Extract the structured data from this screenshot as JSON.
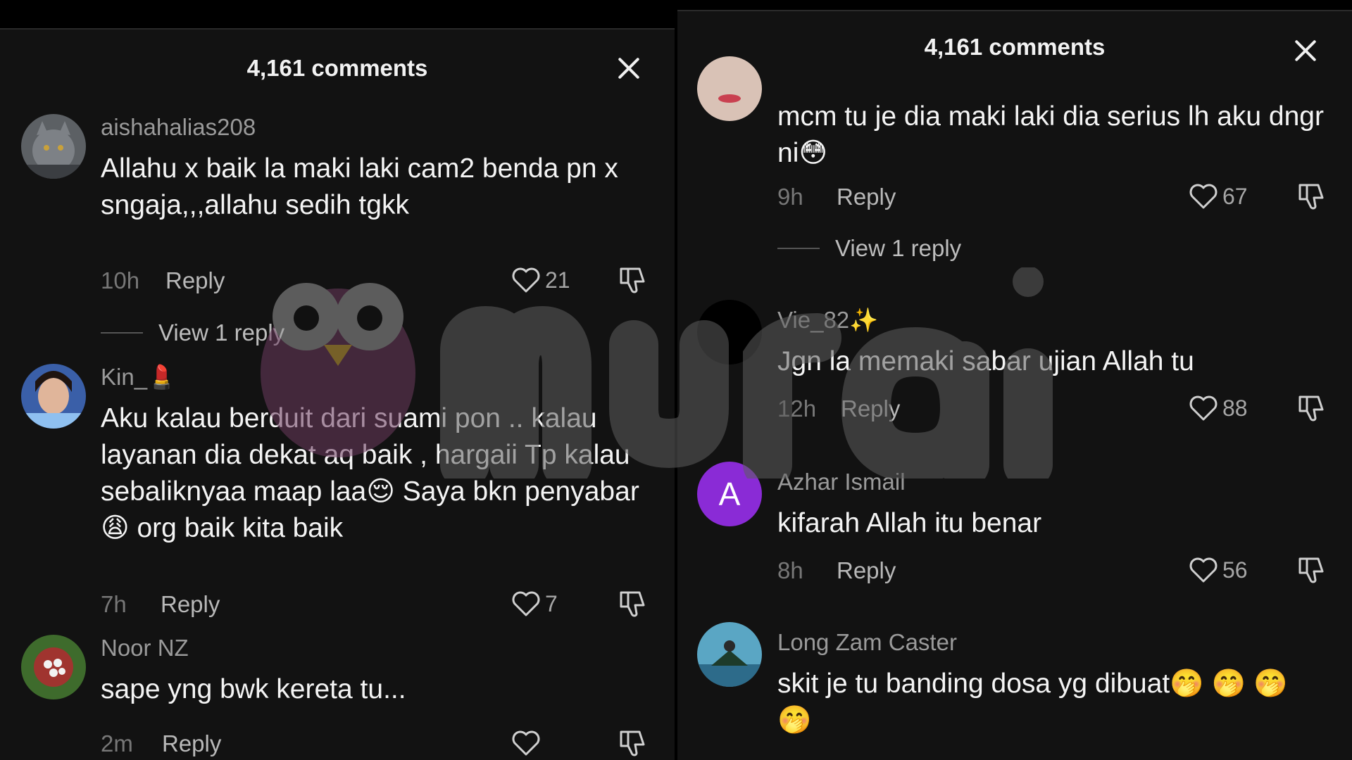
{
  "left": {
    "header_title": "4,161 comments",
    "comments": [
      {
        "username": "aishahalias208",
        "text": "Allahu x baik la maki laki cam2 benda pn x sngaja,,,allahu sedih tgkk",
        "time": "10h",
        "reply_label": "Reply",
        "likes": "21",
        "view_replies": "View 1 reply"
      },
      {
        "username": "Kin_💄",
        "text": "Aku kalau berduit dari suami pon .. kalau layanan dia dekat aq baik , hargaii Tp kalau sebaliknyaa maap laa😌 Saya bkn penyabar 😩 org baik kita baik",
        "time": "7h",
        "reply_label": "Reply",
        "likes": "7"
      },
      {
        "username": "Noor NZ",
        "text": "sape yng bwk kereta tu...",
        "time": "2m",
        "reply_label": "Reply",
        "likes": ""
      }
    ]
  },
  "right": {
    "header_title": "4,161 comments",
    "comments": [
      {
        "username": "",
        "text": "mcm tu je dia maki laki dia serius lh aku dngr ni😳",
        "time": "9h",
        "reply_label": "Reply",
        "likes": "67",
        "view_replies": "View 1 reply"
      },
      {
        "username": "Vie_82✨",
        "text": "Jgn la memaki sabar ujian Allah tu",
        "time": "12h",
        "reply_label": "Reply",
        "likes": "88"
      },
      {
        "username": "Azhar Ismail",
        "avatar_letter": "A",
        "text": "kifarah Allah itu benar",
        "time": "8h",
        "reply_label": "Reply",
        "likes": "56"
      },
      {
        "username": "Long Zam Caster",
        "text": "skit je tu banding dosa yg dibuat🤭 🤭 🤭 🤭",
        "time": "",
        "reply_label": "",
        "likes": ""
      }
    ]
  },
  "watermark": {
    "brand": "murai"
  },
  "colors": {
    "background": "#121212",
    "text_primary": "#f4f4f4",
    "text_secondary": "#9a9a9a",
    "avatar_purple": "#8a2bd6"
  }
}
